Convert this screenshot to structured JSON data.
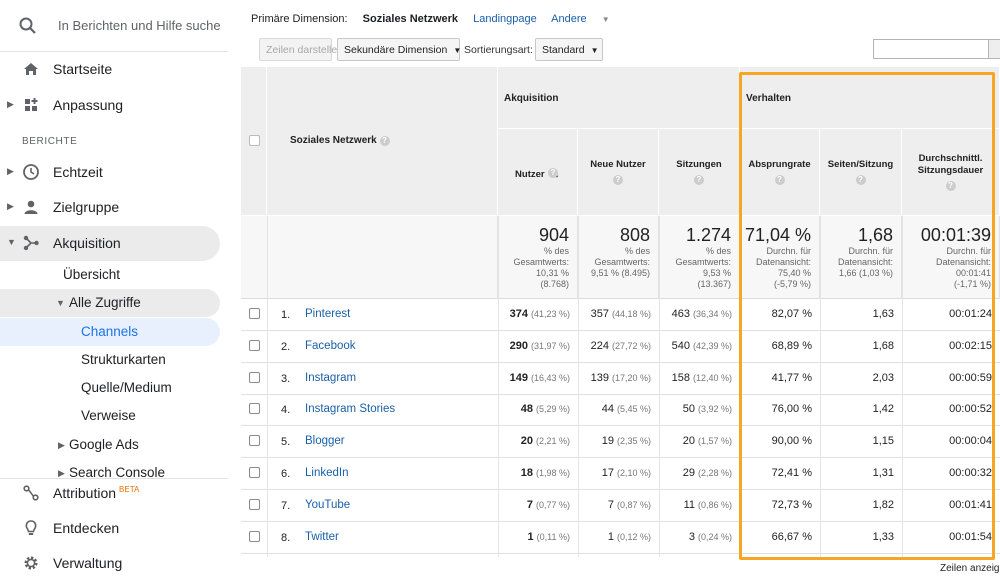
{
  "sidebar": {
    "search_placeholder": "In Berichten und Hilfe suche",
    "home": "Startseite",
    "customization": "Anpassung",
    "reports_section": "BERICHTE",
    "realtime": "Echtzeit",
    "audience": "Zielgruppe",
    "acquisition": "Akquisition",
    "overview": "Übersicht",
    "all_traffic": "Alle Zugriffe",
    "channels": "Channels",
    "treemaps": "Strukturkarten",
    "source_medium": "Quelle/Medium",
    "referrals": "Verweise",
    "google_ads": "Google Ads",
    "search_console": "Search Console",
    "attribution": "Attribution",
    "attribution_badge": "BETA",
    "discover": "Entdecken",
    "admin": "Verwaltung"
  },
  "dimensions": {
    "primary_label": "Primäre Dimension:",
    "active": "Soziales Netzwerk",
    "landing": "Landingpage",
    "other": "Andere"
  },
  "toolbar": {
    "plot_rows": "Zeilen darstellen",
    "secondary_dimension": "Sekundäre Dimension",
    "sort_label": "Sortierungsart:",
    "sort_value": "Standard"
  },
  "table": {
    "first_col": "Soziales Netzwerk",
    "group_acquisition": "Akquisition",
    "group_behavior": "Verhalten",
    "columns": [
      "Nutzer",
      "Neue Nutzer",
      "Sitzungen",
      "Absprungrate",
      "Seiten/Sitzung",
      "Durchschnittl. Sitzungsdauer"
    ],
    "totals": [
      {
        "big": "904",
        "l1": "% des",
        "l2": "Gesamtwerts:",
        "l3": "10,31 %",
        "l4": "(8.768)"
      },
      {
        "big": "808",
        "l1": "% des",
        "l2": "Gesamtwerts:",
        "l3": "9,51 % (8.495)",
        "l4": ""
      },
      {
        "big": "1.274",
        "l1": "% des",
        "l2": "Gesamtwerts:",
        "l3": "9,53 %",
        "l4": "(13.367)"
      },
      {
        "big": "71,04 %",
        "l1": "Durchn. für",
        "l2": "Datenansicht:",
        "l3": "75,40 %",
        "l4": "(-5,79 %)"
      },
      {
        "big": "1,68",
        "l1": "Durchn. für",
        "l2": "Datenansicht:",
        "l3": "1,66 (1,03 %)",
        "l4": ""
      },
      {
        "big": "00:01:39",
        "l1": "Durchn. für",
        "l2": "Datenansicht:",
        "l3": "00:01:41",
        "l4": "(-1,71 %)"
      }
    ],
    "rows": [
      {
        "n": "1.",
        "name": "Pinterest",
        "users": "374",
        "users_pct": "(41,23 %)",
        "new": "357",
        "new_pct": "(44,18 %)",
        "sess": "463",
        "sess_pct": "(36,34 %)",
        "bounce": "82,07 %",
        "pages": "1,63",
        "dur": "00:01:24"
      },
      {
        "n": "2.",
        "name": "Facebook",
        "users": "290",
        "users_pct": "(31,97 %)",
        "new": "224",
        "new_pct": "(27,72 %)",
        "sess": "540",
        "sess_pct": "(42,39 %)",
        "bounce": "68,89 %",
        "pages": "1,68",
        "dur": "00:02:15"
      },
      {
        "n": "3.",
        "name": "Instagram",
        "users": "149",
        "users_pct": "(16,43 %)",
        "new": "139",
        "new_pct": "(17,20 %)",
        "sess": "158",
        "sess_pct": "(12,40 %)",
        "bounce": "41,77 %",
        "pages": "2,03",
        "dur": "00:00:59"
      },
      {
        "n": "4.",
        "name": "Instagram Stories",
        "users": "48",
        "users_pct": "(5,29 %)",
        "new": "44",
        "new_pct": "(5,45 %)",
        "sess": "50",
        "sess_pct": "(3,92 %)",
        "bounce": "76,00 %",
        "pages": "1,42",
        "dur": "00:00:52"
      },
      {
        "n": "5.",
        "name": "Blogger",
        "users": "20",
        "users_pct": "(2,21 %)",
        "new": "19",
        "new_pct": "(2,35 %)",
        "sess": "20",
        "sess_pct": "(1,57 %)",
        "bounce": "90,00 %",
        "pages": "1,15",
        "dur": "00:00:04"
      },
      {
        "n": "6.",
        "name": "LinkedIn",
        "users": "18",
        "users_pct": "(1,98 %)",
        "new": "17",
        "new_pct": "(2,10 %)",
        "sess": "29",
        "sess_pct": "(2,28 %)",
        "bounce": "72,41 %",
        "pages": "1,31",
        "dur": "00:00:32"
      },
      {
        "n": "7.",
        "name": "YouTube",
        "users": "7",
        "users_pct": "(0,77 %)",
        "new": "7",
        "new_pct": "(0,87 %)",
        "sess": "11",
        "sess_pct": "(0,86 %)",
        "bounce": "72,73 %",
        "pages": "1,82",
        "dur": "00:01:41"
      },
      {
        "n": "8.",
        "name": "Twitter",
        "users": "1",
        "users_pct": "(0,11 %)",
        "new": "1",
        "new_pct": "(0,12 %)",
        "sess": "3",
        "sess_pct": "(0,24 %)",
        "bounce": "66,67 %",
        "pages": "1,33",
        "dur": "00:01:54"
      }
    ]
  },
  "footer": {
    "show_rows": "Zeilen anzeig"
  },
  "colors": {
    "highlight": "#f5a623",
    "link": "#1a5fa8",
    "selected_bg": "#e8f0fe",
    "selected_text": "#1a73e8"
  }
}
